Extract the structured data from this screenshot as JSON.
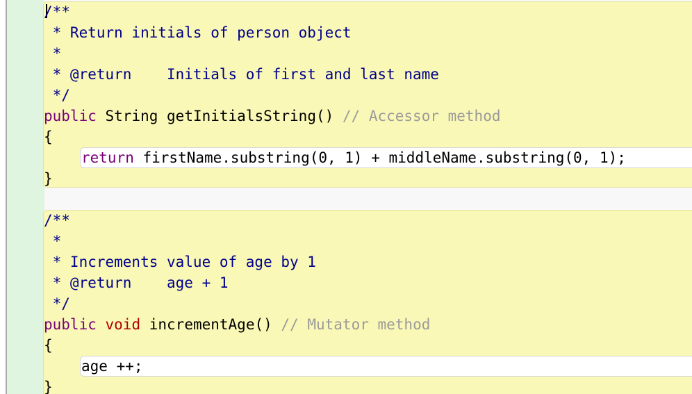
{
  "editor": {
    "colors": {
      "method_background": "#f9f8b6",
      "method_body_background": "#ffffff",
      "gutter_background": "#e0f5e0",
      "comment_color": "#00008b",
      "line_comment_color": "#9a9a9a",
      "keyword_public_color": "#7a0078",
      "keyword_void_color": "#b20000"
    },
    "methods": [
      {
        "doc_lines": [
          "/**",
          " * Return initials of person object",
          " *",
          " * @return    Initials of first and last name",
          " */"
        ],
        "signature": {
          "modifier": "public",
          "return_type": "String",
          "name_and_params": "getInitialsString()",
          "line_comment": "// Accessor method"
        },
        "open_brace": "{",
        "body": {
          "keyword": "return",
          "rest": " firstName.substring(0, 1) + middleName.substring(0, 1);"
        },
        "close_brace": "}"
      },
      {
        "doc_lines": [
          "/**",
          " *",
          " * Increments value of age by 1",
          " * @return    age + 1",
          " */"
        ],
        "signature": {
          "modifier": "public",
          "return_type": "void",
          "name_and_params": "incrementAge()",
          "line_comment": "// Mutator method"
        },
        "open_brace": "{",
        "body": {
          "statement": "age ++;"
        },
        "close_brace": "}"
      }
    ]
  }
}
